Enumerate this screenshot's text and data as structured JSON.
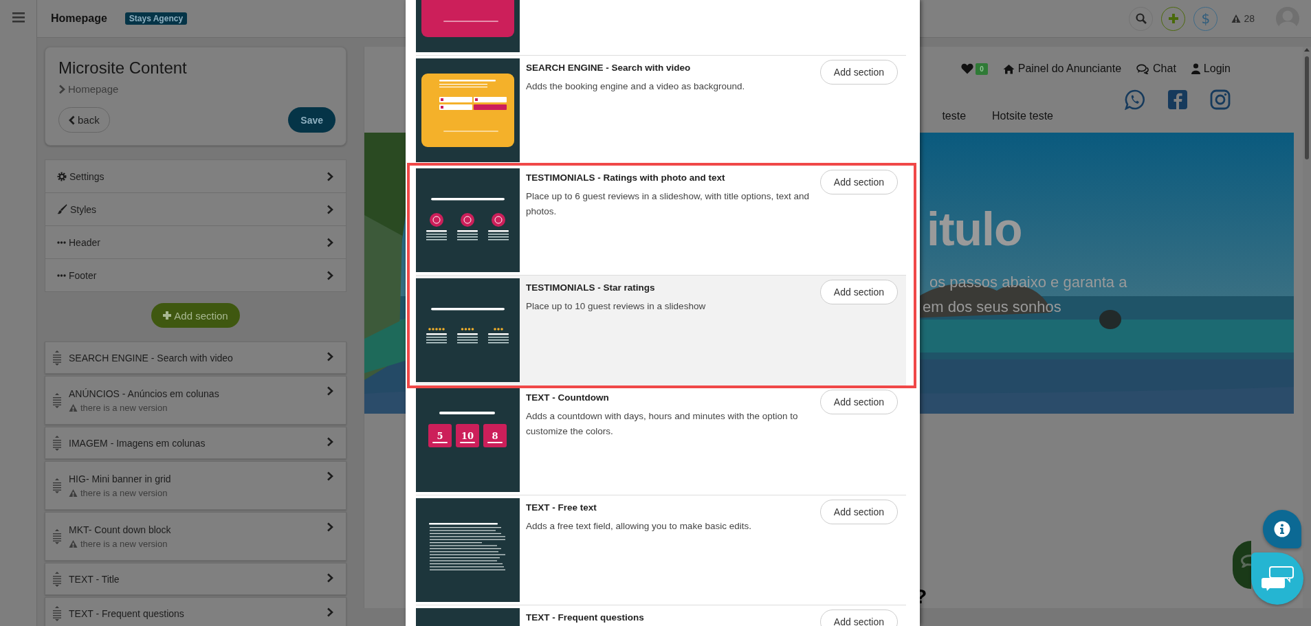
{
  "topbar": {
    "title": "Homepage",
    "badge": "Stays Agency",
    "currency": "$",
    "alert_count": "28"
  },
  "panel": {
    "title": "Microsite Content",
    "breadcrumb": "Homepage",
    "back": "back",
    "save": "Save"
  },
  "menu_items": [
    {
      "label": "Settings",
      "kind": "gear"
    },
    {
      "label": "Styles",
      "kind": "brush"
    },
    {
      "label": "Header",
      "kind": "dots"
    },
    {
      "label": "Footer",
      "kind": "dots"
    }
  ],
  "add_section": "Add section",
  "sections": [
    {
      "title": "SEARCH ENGINE - Search with video"
    },
    {
      "title": "ANÚNCIOS - Anúncios em colunas",
      "notice": "there is a new version"
    },
    {
      "title": "IMAGEM - Imagens em colunas"
    },
    {
      "title": "HIG- Mini banner in grid",
      "notice": "there is a new version"
    },
    {
      "title": "MKT- Count down block",
      "notice": "there is a new version"
    },
    {
      "title": "TEXT - Title"
    },
    {
      "title": "TEXT - Frequent questions"
    }
  ],
  "preview": {
    "favorites_count": "0",
    "nav": [
      {
        "label": "Painel do Anunciante",
        "kind": "home"
      },
      {
        "label": "Chat",
        "kind": "chat"
      },
      {
        "label": "Login",
        "kind": "user"
      }
    ],
    "menu": [
      "teste",
      "Hotsite teste"
    ],
    "social": [
      {
        "kind": "whatsapp"
      },
      {
        "kind": "facebook"
      },
      {
        "kind": "instagram"
      }
    ],
    "hero_title": "itulo",
    "hero_lines": [
      "os passos abaixo e garanta a",
      "em dos seus sonhos"
    ],
    "below_text": "?"
  },
  "modal": {
    "items": [
      {
        "kind": "search-pink",
        "highlighted": false,
        "hovered": false
      },
      {
        "kind": "search-yellow",
        "title": "SEARCH ENGINE - Search with video",
        "description": "Adds the booking engine and a video as background.",
        "button": "Add section",
        "highlighted": false,
        "hovered": false
      },
      {
        "kind": "smileys",
        "title": "TESTIMONIALS - Ratings with photo and text",
        "description": "Place up to 6 guest reviews in a slideshow, with title options, text and photos.",
        "button": "Add section",
        "highlighted": true,
        "hovered": false
      },
      {
        "kind": "stars",
        "title": "TESTIMONIALS - Star ratings",
        "description": "Place up to 10 guest reviews in a slideshow",
        "button": "Add section",
        "highlighted": true,
        "hovered": true
      },
      {
        "kind": "countdown",
        "digits": [
          "5",
          "10",
          "8"
        ],
        "title": "TEXT - Countdown",
        "description": "Adds a countdown with days, hours and minutes with the option to customize the colors.",
        "button": "Add section",
        "highlighted": false,
        "hovered": false
      },
      {
        "kind": "lines",
        "title": "TEXT - Free text",
        "description": "Adds a free text field, allowing you to make basic edits.",
        "button": "Add section",
        "highlighted": false,
        "hovered": false
      },
      {
        "kind": "plain",
        "title": "TEXT - Frequent questions",
        "button": "Add section",
        "highlighted": false,
        "hovered": false
      }
    ]
  }
}
